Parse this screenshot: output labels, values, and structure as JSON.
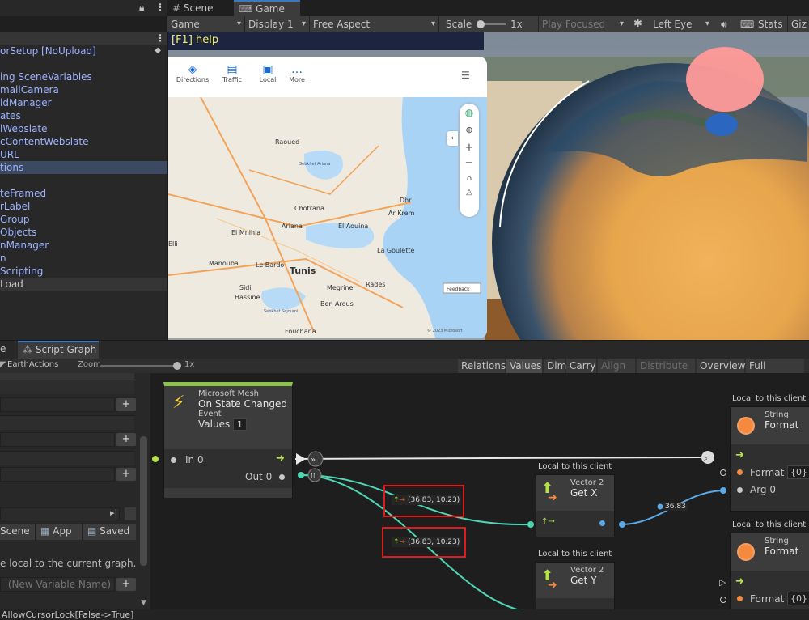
{
  "hierarchy": {
    "items": [
      "orSetup [NoUpload]",
      "",
      "ing SceneVariables",
      "mailCamera",
      "ldManager",
      "ates",
      "lWebslate",
      "cContentWebslate",
      "URL",
      "tions",
      "",
      "teFramed",
      "rLabel",
      "Group",
      "Objects",
      "nManager",
      "n",
      "Scripting",
      "Load"
    ],
    "selected_index": 9
  },
  "editor": {
    "tabs": [
      "Scene",
      "Game"
    ],
    "active_tab": "Game"
  },
  "game_toolbar": {
    "view": "Game",
    "display": "Display 1",
    "aspect": "Free Aspect",
    "scale_label": "Scale",
    "scale_value": "1x",
    "play_focused": "Play Focused",
    "eye": "Left Eye",
    "stats": "Stats",
    "gizmos": "Giz"
  },
  "game_view": {
    "help_text": "[F1] help",
    "map_tabs": [
      "Directions",
      "Traffic",
      "Local",
      "More"
    ],
    "map_places": [
      "Raoued",
      "Sebkhet Ariana",
      "Chotrana",
      "Ariana",
      "Dhr",
      "El Aouina",
      "Ar Krem",
      "El Mnihla",
      "La Goulette",
      "Elli",
      "Manouba",
      "Le Bardo",
      "Tunis",
      "Sidi",
      "Hassine",
      "Megrine",
      "Rades",
      "Ben Arous",
      "Fouchana",
      "Sebkhet Sejoumi"
    ],
    "map_scale": "Feedback",
    "map_copyright": "© 2023 Microsoft"
  },
  "graph_tabs": {
    "partial": "e",
    "script_graph": "Script Graph"
  },
  "graph_toolbar": {
    "breadcrumb": "EarthActions",
    "zoom_label": "Zoom",
    "zoom_value": "1x",
    "buttons": [
      "Relations",
      "Values",
      "Dim",
      "Carry",
      "Align",
      "Distribute",
      "Overview",
      "Full Screen"
    ],
    "active": "Values",
    "disabled": [
      "Align",
      "Distribute"
    ]
  },
  "blackboard": {
    "scopes": [
      "Scene",
      "App",
      "Saved"
    ],
    "hint": "e local to the current graph.",
    "new_var_placeholder": "(New Variable Name)"
  },
  "nodes": {
    "event": {
      "category": "Microsoft Mesh",
      "title": "On State Changed",
      "kind": "Event",
      "values_label": "Values",
      "values_count": "1",
      "in_label": "In 0",
      "out_label": "Out 0"
    },
    "getx": {
      "caption": "Local to this client",
      "category": "Vector 2",
      "title": "Get X"
    },
    "gety": {
      "caption": "Local to this client",
      "category": "Vector 2",
      "title": "Get Y"
    },
    "format1": {
      "caption": "Local to this client",
      "category": "String",
      "title": "Format",
      "format_label": "Format",
      "format_value": "{0}",
      "arg_label": "Arg 0"
    },
    "format2": {
      "caption": "Local to this client",
      "category": "String",
      "title": "Format",
      "format_label": "Format",
      "format_value": "{0}"
    }
  },
  "value_labels": {
    "vec1": "(36.83, 10.23)",
    "vec2": "(36.83, 10.23)",
    "float": "36.83"
  },
  "status": {
    "text": "AllowCursorLock[False->True]"
  },
  "colors": {
    "accent_blue": "#3a79bb",
    "flow_green": "#b6e34a",
    "data_teal": "#4fd6b4",
    "float_blue": "#5aa9e6",
    "highlight_red": "#e11b1b",
    "string_orange": "#f58a3e"
  }
}
